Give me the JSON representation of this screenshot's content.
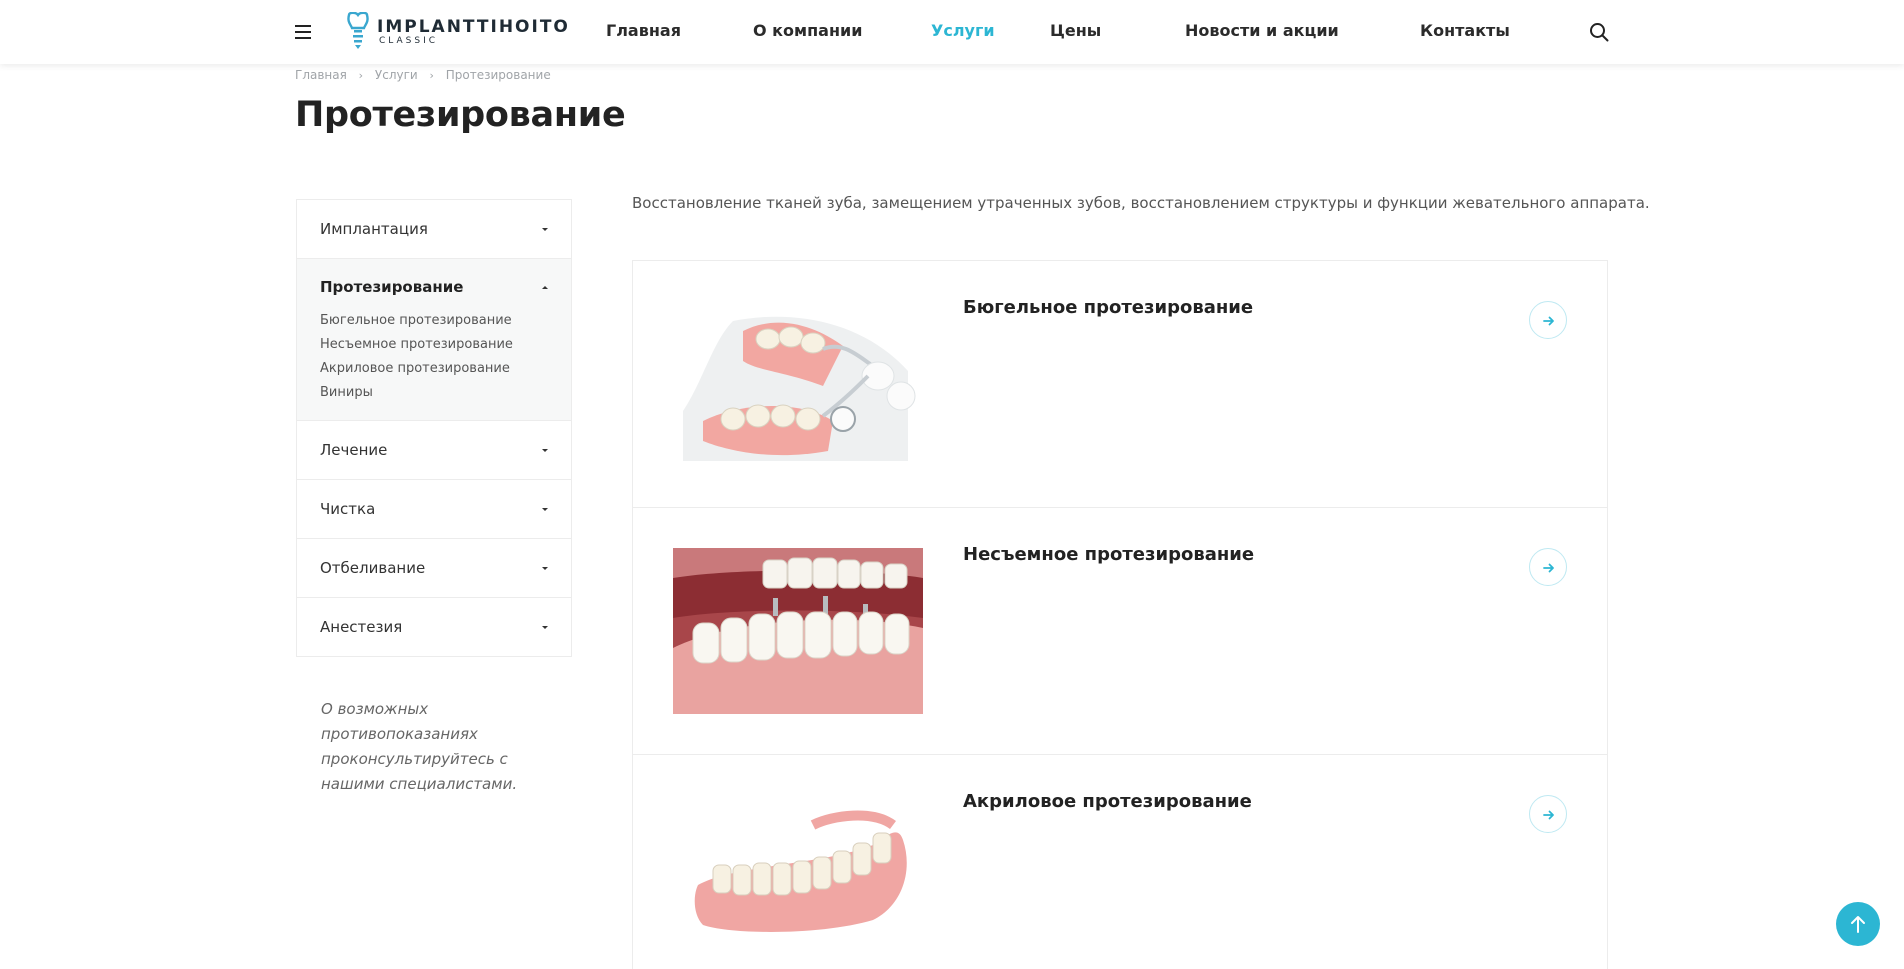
{
  "header": {
    "logo": {
      "title": "IMPLANTTIHOITO",
      "subtitle": "CLASSIC"
    },
    "nav": [
      {
        "label": "Главная",
        "active": false
      },
      {
        "label": "О компании",
        "active": false
      },
      {
        "label": "Услуги",
        "active": true
      },
      {
        "label": "Цены",
        "active": false
      },
      {
        "label": "Новости и акции",
        "active": false
      },
      {
        "label": "Контакты",
        "active": false
      }
    ],
    "icons": {
      "menu": "hamburger-menu-icon",
      "search": "search-icon"
    }
  },
  "breadcrumb": [
    "Главная",
    "Услуги",
    "Протезирование"
  ],
  "page_title": "Протезирование",
  "sidebar": {
    "items": [
      {
        "label": "Имплантация",
        "expanded": false
      },
      {
        "label": "Протезирование",
        "expanded": true,
        "children": [
          "Бюгельное протезирование",
          "Несъемное протезирование",
          "Акриловое протезирование",
          "Виниры"
        ]
      },
      {
        "label": "Лечение",
        "expanded": false
      },
      {
        "label": "Чистка",
        "expanded": false
      },
      {
        "label": "Отбеливание",
        "expanded": false
      },
      {
        "label": "Анестезия",
        "expanded": false
      }
    ],
    "note": "О возможных противопоказаниях проконсультируйтесь с нашими специалистами."
  },
  "main": {
    "intro": "Восстановление тканей зуба, замещением утраченных зубов, восстановлением структуры и функции жевательного аппарата.",
    "cards": [
      {
        "title": "Бюгельное протезирование"
      },
      {
        "title": "Несъемное протезирование"
      },
      {
        "title": "Акриловое протезирование"
      }
    ]
  },
  "colors": {
    "accent": "#2cb6d3",
    "text": "#222222",
    "border": "#ececec"
  }
}
